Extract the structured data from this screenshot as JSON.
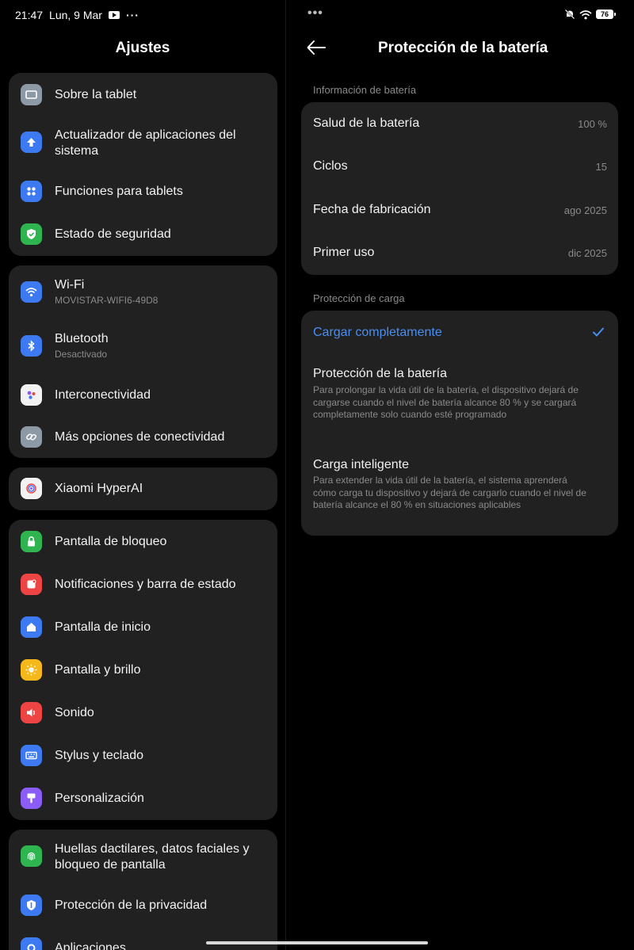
{
  "status_bar": {
    "time": "21:47",
    "date": "Lun, 9 Mar",
    "more": "···",
    "battery": "76",
    "dots": "•••"
  },
  "left": {
    "title": "Ajustes",
    "groups": [
      {
        "items": [
          {
            "title": "Sobre la tablet",
            "icon": "tablet-icon",
            "color": "#8e99a6"
          },
          {
            "title": "Actualizador de aplicaciones del sistema",
            "icon": "arrow-up-icon",
            "color": "#3d7af2"
          },
          {
            "title": "Funciones para tablets",
            "icon": "grid-icon",
            "color": "#3d7af2"
          },
          {
            "title": "Estado de seguridad",
            "icon": "shield-check-icon",
            "color": "#2fb550"
          }
        ]
      },
      {
        "items": [
          {
            "title": "Wi-Fi",
            "subtitle": "MOVISTAR-WIFI6-49D8",
            "icon": "wifi-icon",
            "color": "#3d7af2"
          },
          {
            "title": "Bluetooth",
            "subtitle": "Desactivado",
            "icon": "bluetooth-icon",
            "color": "#3d7af2"
          },
          {
            "title": "Interconectividad",
            "icon": "interconnect-icon",
            "color": "#f2f2f2"
          },
          {
            "title": "Más opciones de conectividad",
            "icon": "link-icon",
            "color": "#8e99a6"
          }
        ]
      },
      {
        "items": [
          {
            "title": "Xiaomi HyperAI",
            "icon": "hyperai-icon",
            "color": "#f2f2f2"
          }
        ]
      },
      {
        "items": [
          {
            "title": "Pantalla de bloqueo",
            "icon": "lock-icon",
            "color": "#2fb550"
          },
          {
            "title": "Notificaciones y barra de estado",
            "icon": "notification-icon",
            "color": "#ef4444"
          },
          {
            "title": "Pantalla de inicio",
            "icon": "home-icon",
            "color": "#3d7af2"
          },
          {
            "title": "Pantalla y brillo",
            "icon": "sun-icon",
            "color": "#f5b719"
          },
          {
            "title": "Sonido",
            "icon": "speaker-icon",
            "color": "#ef4444"
          },
          {
            "title": "Stylus y teclado",
            "icon": "keyboard-icon",
            "color": "#3d7af2"
          },
          {
            "title": "Personalización",
            "icon": "brush-icon",
            "color": "#8b5cf6"
          }
        ]
      },
      {
        "items": [
          {
            "title": "Huellas dactilares, datos faciales y bloqueo de pantalla",
            "icon": "fingerprint-icon",
            "color": "#2fb550"
          },
          {
            "title": "Protección de la privacidad",
            "icon": "privacy-icon",
            "color": "#3d7af2"
          },
          {
            "title": "Aplicaciones",
            "icon": "apps-icon",
            "color": "#3d7af2"
          }
        ]
      }
    ]
  },
  "right": {
    "title": "Protección de la batería",
    "battery_info_label": "Información de batería",
    "battery_info": [
      {
        "label": "Salud de la batería",
        "value": "100 %"
      },
      {
        "label": "Ciclos",
        "value": "15"
      },
      {
        "label": "Fecha de fabricación",
        "value": "ago 2025"
      },
      {
        "label": "Primer uso",
        "value": "dic 2025"
      }
    ],
    "charge_label": "Protección de carga",
    "options": [
      {
        "title": "Cargar completamente",
        "selected": true
      },
      {
        "title": "Protección de la batería",
        "desc": "Para prolongar la vida útil de la batería, el dispositivo dejará de cargarse cuando el nivel de batería alcance 80 % y se cargará completamente solo cuando esté programado"
      },
      {
        "title": "Carga inteligente",
        "desc": "Para extender la vida útil de la batería, el sistema aprenderá cómo carga tu dispositivo y dejará de cargarlo cuando el nivel de batería alcance el 80 % en situaciones aplicables"
      }
    ]
  },
  "colors": {
    "accent": "#4a8ef0",
    "card": "#212121",
    "background": "#000000"
  }
}
